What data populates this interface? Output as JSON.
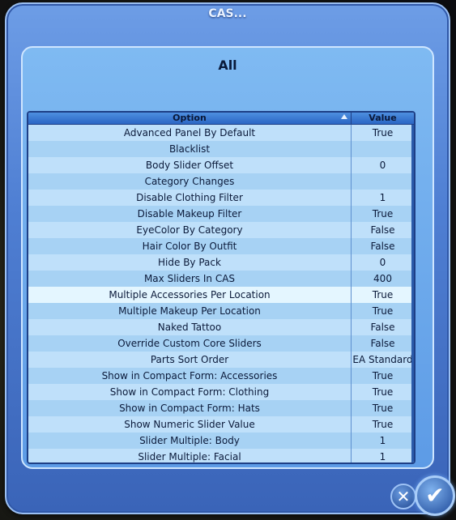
{
  "dialog": {
    "title": "CAS..."
  },
  "panel": {
    "title": "All"
  },
  "table": {
    "headers": {
      "option": "Option",
      "value": "Value"
    },
    "rows": [
      {
        "option": "Advanced Panel By Default",
        "value": "True"
      },
      {
        "option": "Blacklist",
        "value": ""
      },
      {
        "option": "Body Slider Offset",
        "value": "0"
      },
      {
        "option": "Category Changes",
        "value": ""
      },
      {
        "option": "Disable Clothing Filter",
        "value": "1"
      },
      {
        "option": "Disable Makeup Filter",
        "value": "True"
      },
      {
        "option": "EyeColor By Category",
        "value": "False"
      },
      {
        "option": "Hair Color By Outfit",
        "value": "False"
      },
      {
        "option": "Hide By Pack",
        "value": "0"
      },
      {
        "option": "Max Sliders In CAS",
        "value": "400"
      },
      {
        "option": "Multiple Accessories Per Location",
        "value": "True"
      },
      {
        "option": "Multiple Makeup Per Location",
        "value": "True"
      },
      {
        "option": "Naked Tattoo",
        "value": "False"
      },
      {
        "option": "Override Custom Core Sliders",
        "value": "False"
      },
      {
        "option": "Parts Sort Order",
        "value": "EA Standard"
      },
      {
        "option": "Show in Compact Form: Accessories",
        "value": "True"
      },
      {
        "option": "Show in Compact Form: Clothing",
        "value": "True"
      },
      {
        "option": "Show in Compact Form: Hats",
        "value": "True"
      },
      {
        "option": "Show Numeric Slider Value",
        "value": "True"
      },
      {
        "option": "Slider Multiple: Body",
        "value": "1"
      },
      {
        "option": "Slider Multiple: Facial",
        "value": "1"
      }
    ]
  },
  "buttons": {
    "close_icon": "close-icon",
    "ok_icon": "checkmark-icon"
  }
}
